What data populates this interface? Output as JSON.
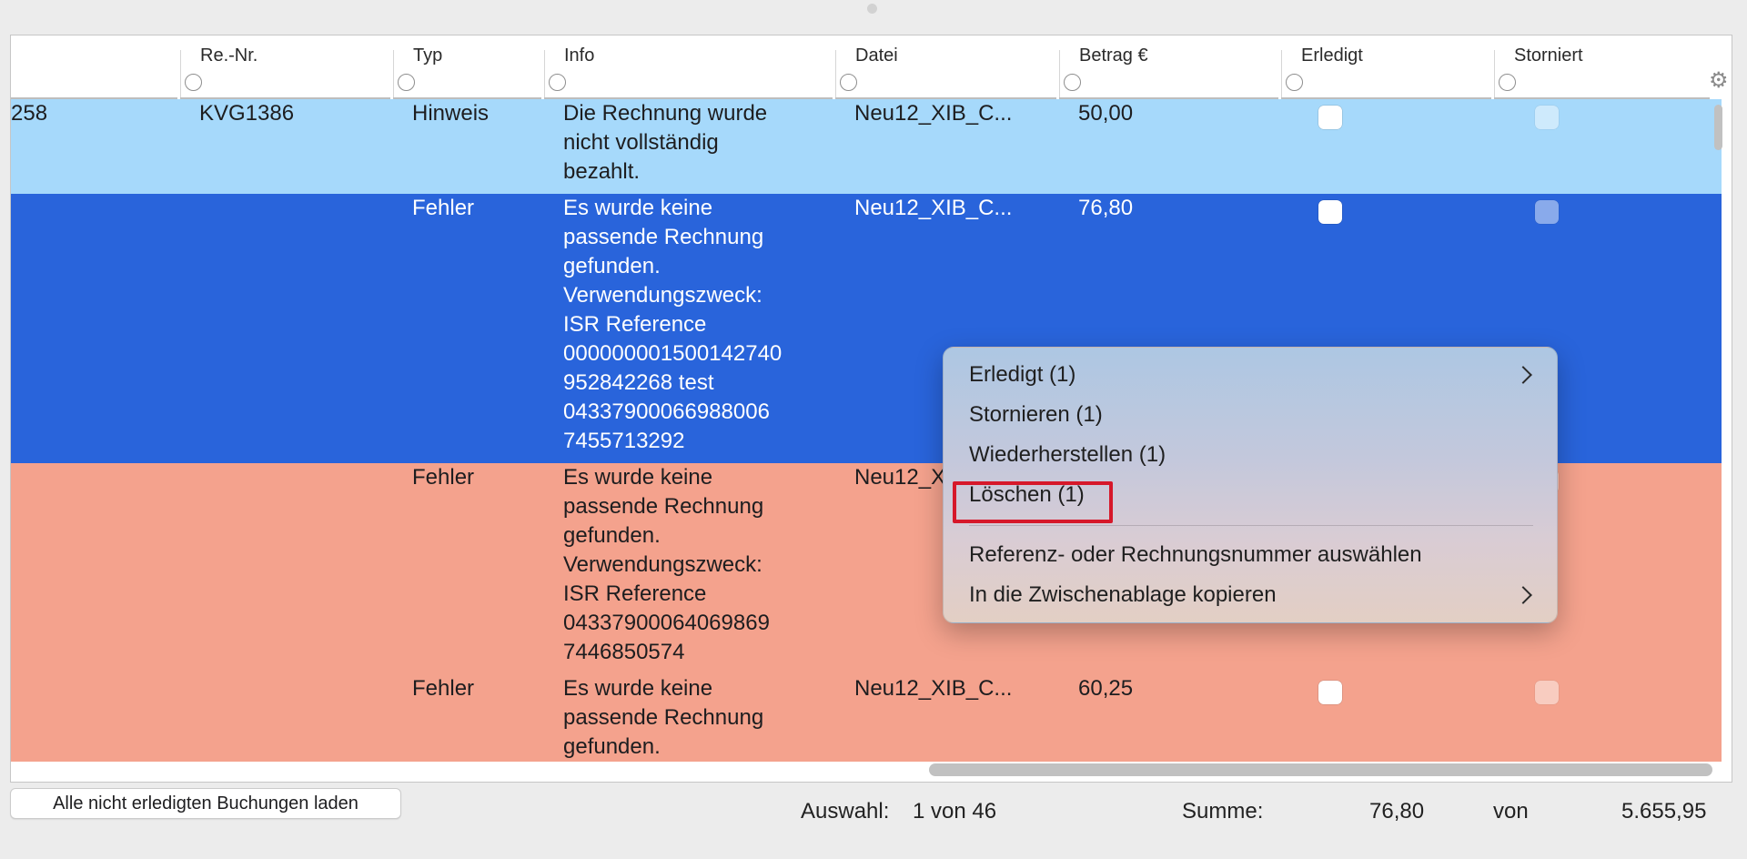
{
  "colors": {
    "row_hint": "#a6d9fb",
    "row_selected": "#2964db",
    "row_error": "#f4a28d",
    "highlight": "#d6182a"
  },
  "columns": [
    {
      "key": "id",
      "label": ""
    },
    {
      "key": "re_nr",
      "label": "Re.-Nr."
    },
    {
      "key": "typ",
      "label": "Typ"
    },
    {
      "key": "info",
      "label": "Info"
    },
    {
      "key": "datei",
      "label": "Datei"
    },
    {
      "key": "betrag",
      "label": "Betrag €"
    },
    {
      "key": "erledigt",
      "label": "Erledigt"
    },
    {
      "key": "storniert",
      "label": "Storniert"
    }
  ],
  "header_icons": {
    "settings": "gear-icon"
  },
  "rows": [
    {
      "state": "hint",
      "id": "258",
      "re_nr": "KVG1386",
      "typ": "Hinweis",
      "info": [
        "Die Rechnung wurde",
        "nicht vollständig",
        "bezahlt."
      ],
      "datei": "Neu12_XIB_C...",
      "betrag": "50,00",
      "erledigt": false,
      "storniert": false
    },
    {
      "state": "selected",
      "id": "",
      "re_nr": "",
      "typ": "Fehler",
      "info": [
        "Es wurde keine",
        "passende Rechnung",
        "gefunden.",
        "Verwendungszweck:",
        "ISR Reference",
        "000000001500142740",
        "952842268 test",
        "04337900066988006",
        "7455713292"
      ],
      "datei": "Neu12_XIB_C...",
      "betrag": "76,80",
      "erledigt": false,
      "storniert": false
    },
    {
      "state": "error",
      "id": "",
      "re_nr": "",
      "typ": "Fehler",
      "info": [
        "Es wurde keine",
        "passende Rechnung",
        "gefunden.",
        "Verwendungszweck:",
        "ISR Reference",
        "04337900064069869",
        "7446850574"
      ],
      "datei": "Neu12_X",
      "betrag": "",
      "erledigt": false,
      "storniert": false
    },
    {
      "state": "error",
      "id": "",
      "re_nr": "",
      "typ": "Fehler",
      "info": [
        "Es wurde keine",
        "passende Rechnung",
        "gefunden."
      ],
      "datei": "Neu12_XIB_C...",
      "betrag": "60,25",
      "erledigt": false,
      "storniert": false
    }
  ],
  "context_menu": {
    "items": [
      {
        "label": "Erledigt (1)",
        "submenu": true
      },
      {
        "label": "Stornieren (1)",
        "submenu": false
      },
      {
        "label": "Wiederherstellen (1)",
        "submenu": false
      },
      {
        "label": "Löschen (1)",
        "submenu": false,
        "highlighted": true
      },
      {
        "separator": true
      },
      {
        "label": "Referenz- oder Rechnungsnummer auswählen",
        "submenu": false
      },
      {
        "label": "In die Zwischenablage kopieren",
        "submenu": true
      }
    ]
  },
  "footer": {
    "load_button": "Alle nicht erledigten Buchungen laden",
    "selection_label": "Auswahl:",
    "selection_value": "1 von 46",
    "sum_label": "Summe:",
    "sum_value": "76,80",
    "of_label": "von",
    "total_value": "5.655,95"
  }
}
